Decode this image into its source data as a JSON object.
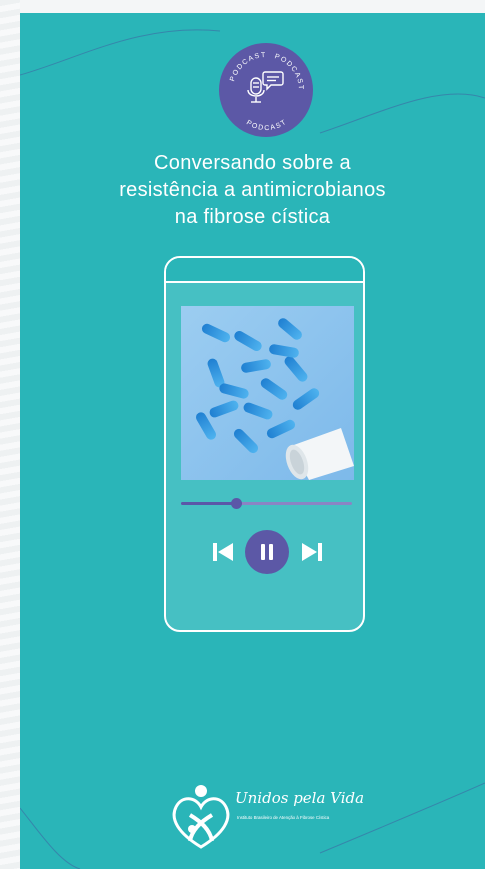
{
  "podcast_badge": {
    "ring_text_top": "PODCAST",
    "ring_text_right": "PODCAST",
    "ring_text_bottom": "PODCAST",
    "icons": [
      "microphone-icon",
      "speech-bubble-icon"
    ]
  },
  "headline": {
    "line1": "Conversando sobre  a",
    "line2": "resistência a antimicrobianos",
    "line3": "na fibrose cística"
  },
  "player": {
    "cover_image": "blue-capsules-pill-bottle",
    "progress": 0.32,
    "controls": [
      "previous-icon",
      "pause-icon",
      "next-icon"
    ],
    "state": "playing"
  },
  "brand": {
    "name": "Unidos pela Vida",
    "tagline": "Instituto Brasileiro de Atenção à Fibrose Cística"
  },
  "colors": {
    "background": "#2ab5b8",
    "accent": "#5c58a6",
    "text": "#ffffff"
  }
}
